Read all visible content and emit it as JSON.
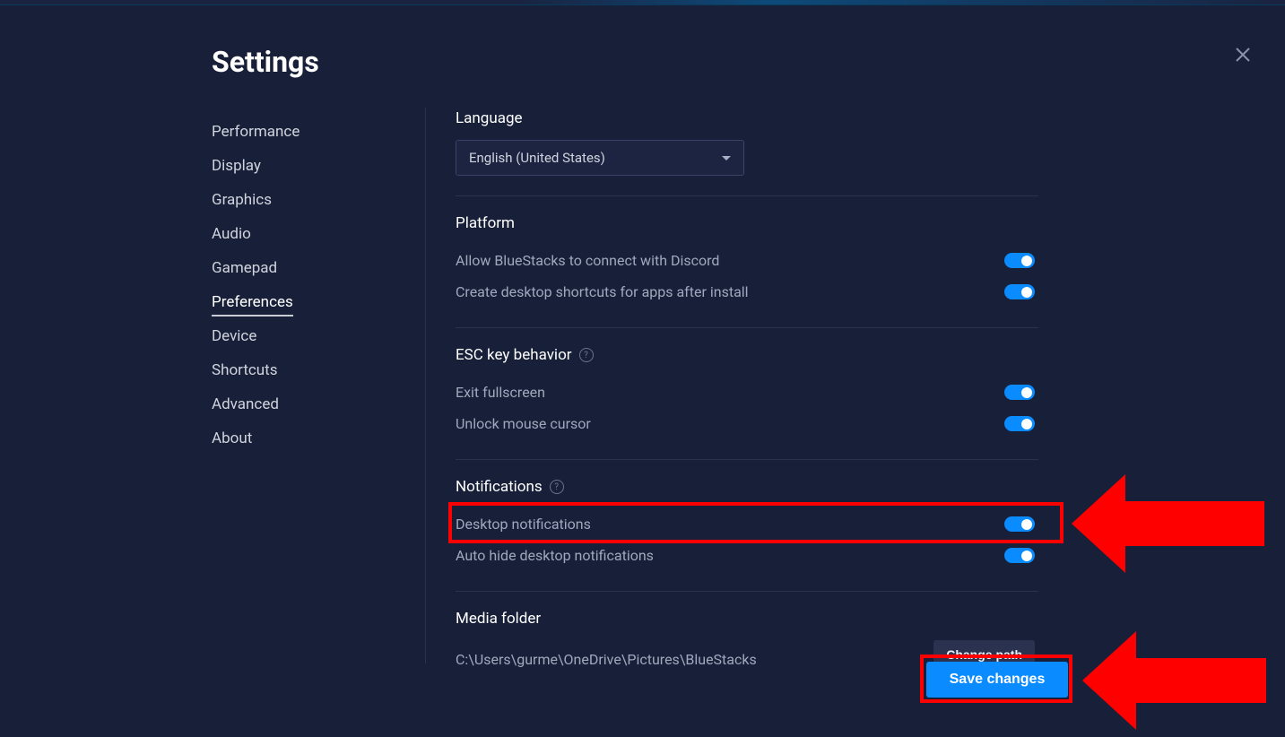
{
  "title": "Settings",
  "sidebar": {
    "items": [
      {
        "label": "Performance"
      },
      {
        "label": "Display"
      },
      {
        "label": "Graphics"
      },
      {
        "label": "Audio"
      },
      {
        "label": "Gamepad"
      },
      {
        "label": "Preferences"
      },
      {
        "label": "Device"
      },
      {
        "label": "Shortcuts"
      },
      {
        "label": "Advanced"
      },
      {
        "label": "About"
      }
    ],
    "activeIndex": 5
  },
  "language": {
    "header": "Language",
    "selected": "English (United States)"
  },
  "platform": {
    "header": "Platform",
    "discord_label": "Allow BlueStacks to connect with Discord",
    "shortcuts_label": "Create desktop shortcuts for apps after install"
  },
  "esc": {
    "header": "ESC key behavior",
    "exit_fullscreen_label": "Exit fullscreen",
    "unlock_mouse_label": "Unlock mouse cursor"
  },
  "notifications": {
    "header": "Notifications",
    "desktop_label": "Desktop notifications",
    "autohide_label": "Auto hide desktop notifications"
  },
  "media": {
    "header": "Media folder",
    "path": "C:\\Users\\gurme\\OneDrive\\Pictures\\BlueStacks",
    "change_path_label": "Change path"
  },
  "save_label": "Save changes"
}
